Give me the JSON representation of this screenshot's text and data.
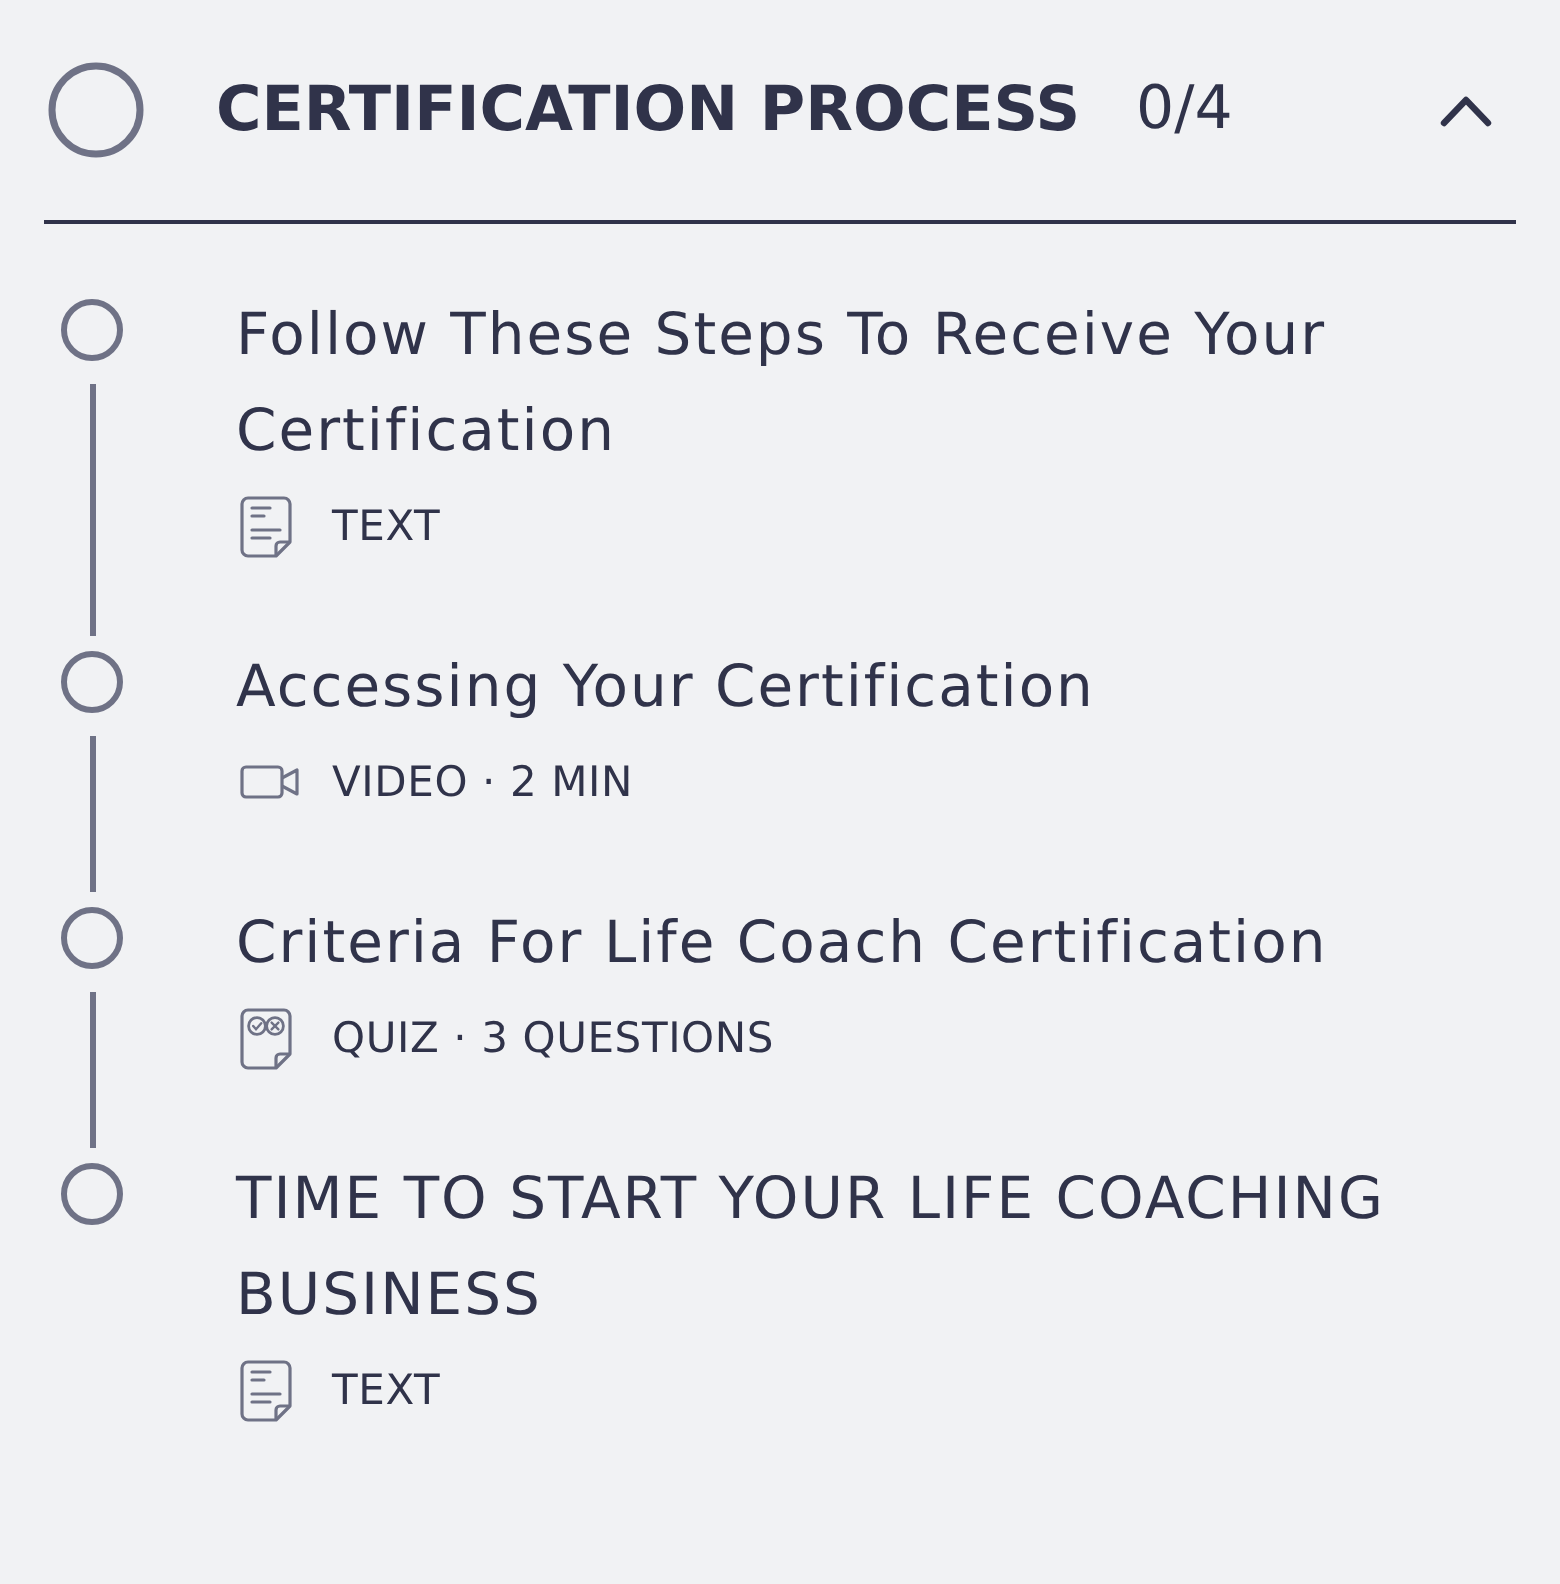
{
  "section": {
    "title": "CERTIFICATION PROCESS",
    "progress": "0/4",
    "completed": false,
    "expanded": true
  },
  "lessons": [
    {
      "title": "Follow These Steps To Receive Your Certification",
      "kind": "text",
      "meta": "TEXT",
      "completed": false
    },
    {
      "title": "Accessing Your Certification",
      "kind": "video",
      "meta": "VIDEO · 2 MIN",
      "completed": false
    },
    {
      "title": "Criteria For Life Coach Certification",
      "kind": "quiz",
      "meta": "QUIZ · 3 QUESTIONS",
      "completed": false
    },
    {
      "title": "TIME TO START YOUR LIFE COACHING BUSINESS",
      "kind": "text",
      "meta": "TEXT",
      "completed": false
    }
  ]
}
